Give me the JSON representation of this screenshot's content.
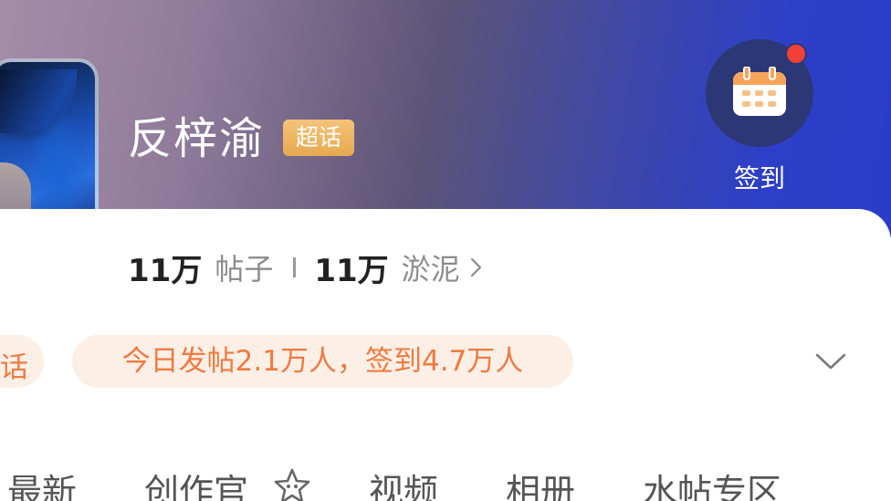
{
  "topic": {
    "name": "反梓渝",
    "badge": "超话"
  },
  "checkin": {
    "label": "签到",
    "has_notification": true
  },
  "stats": {
    "posts_count": "11万",
    "posts_label": "帖子",
    "members_count": "11万",
    "members_label": "淤泥"
  },
  "pills": {
    "left_partial": "话",
    "activity": "今日发帖2.1万人，签到4.7万人"
  },
  "tabs": [
    {
      "label": "最新"
    },
    {
      "label": "创作官"
    },
    {
      "label": "视频"
    },
    {
      "label": "相册"
    },
    {
      "label": "水帖专区"
    }
  ],
  "colors": {
    "accent_orange": "#f07a3f",
    "badge_gold": "#e7a94f",
    "notification_red": "#f0403a",
    "checkin_circle": "#2c3775"
  },
  "icons": {
    "checkin": "calendar-icon",
    "stats_more": "chevron-right-icon",
    "expand": "chevron-down-icon",
    "creator_tab": "star-icon"
  }
}
